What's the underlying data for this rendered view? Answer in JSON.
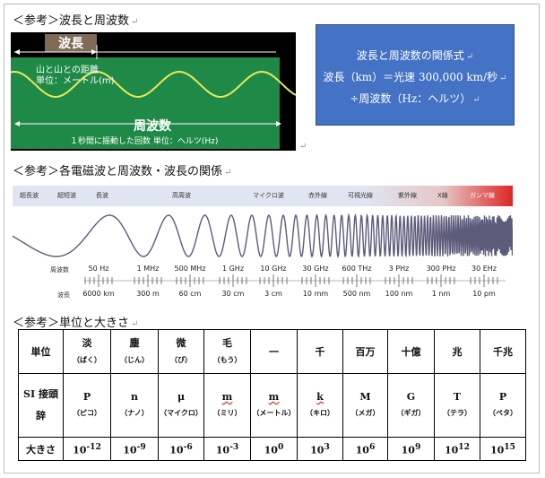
{
  "headings": {
    "wave_section": "＜参考＞波長と周波数",
    "em_section": "＜参考＞各電磁波と周波数・波長の関係",
    "unit_section": "＜参考＞単位と大きさ"
  },
  "wave_figure": {
    "wavelength_label": "波長",
    "distance_line1": "山と山との距離",
    "distance_line2": "単位：メートル(m)",
    "frequency_label": "周波数",
    "frequency_desc": "１秒間に振動した回数 単位：ヘルツ(Hz)"
  },
  "formula_box": {
    "line1": "波長と周波数の関係式",
    "line2": "波長（km）＝光速 300,000 km/秒",
    "line3": "÷周波数（Hz：ヘルツ）"
  },
  "spectrum": {
    "bands": [
      "超長波",
      "超短波",
      "長波",
      "高周波",
      "マイクロ波",
      "赤外線",
      "可視光線",
      "紫外線",
      "X線",
      "ガンマ線"
    ],
    "row_title_freq": "周波数",
    "row_title_wl": "波長",
    "frequencies": [
      "50 Hz",
      "1 MHz",
      "500 MHz",
      "1 GHz",
      "10 GHz",
      "30 GHz",
      "600 THz",
      "3 PHz",
      "300 PHz",
      "30 EHz"
    ],
    "wavelengths": [
      "6000 km",
      "300 m",
      "60 cm",
      "30 cm",
      "3 cm",
      "10 mm",
      "500 nm",
      "100 nm",
      "1 nm",
      "10 pm"
    ]
  },
  "units_table": {
    "names": [
      "単位",
      "淡",
      "塵",
      "微",
      "毛",
      "一",
      "千",
      "百万",
      "十億",
      "兆",
      "千兆"
    ],
    "readings": [
      "（ばく）",
      "（じん）",
      "（び）",
      "（もう）"
    ],
    "prefix_header": [
      "SI 接頭",
      "辞"
    ],
    "prefixes": [
      {
        "symbol": "P",
        "reading": "（ピコ）"
      },
      {
        "symbol": "n",
        "reading": "（ナノ）"
      },
      {
        "symbol": "μ",
        "reading": "（マイクロ）"
      },
      {
        "symbol": "m",
        "reading": "（ミリ）"
      },
      {
        "symbol": "m",
        "reading": "（メートル）"
      },
      {
        "symbol": "k",
        "reading": "（キロ）"
      },
      {
        "symbol": "M",
        "reading": "（メガ）"
      },
      {
        "symbol": "G",
        "reading": "（ギガ）"
      },
      {
        "symbol": "T",
        "reading": "（テラ）"
      },
      {
        "symbol": "P",
        "reading": "（ペタ）"
      }
    ],
    "size_header": "大きさ",
    "sizes": [
      {
        "base": "10",
        "exp": "-12"
      },
      {
        "base": "10",
        "exp": "-9"
      },
      {
        "base": "10",
        "exp": "-6"
      },
      {
        "base": "10",
        "exp": "-3"
      },
      {
        "base": "10",
        "exp": "0"
      },
      {
        "base": "10",
        "exp": "3"
      },
      {
        "base": "10",
        "exp": "6"
      },
      {
        "base": "10",
        "exp": "9"
      },
      {
        "base": "10",
        "exp": "12"
      },
      {
        "base": "10",
        "exp": "15"
      }
    ]
  },
  "colors": {
    "formula_bg": "#4472c4",
    "wave_green": "#1f8a47",
    "wave_line": "#e8e85a",
    "spectrum_red": "#dd2626"
  },
  "icons": {
    "return_mark": "↵"
  }
}
